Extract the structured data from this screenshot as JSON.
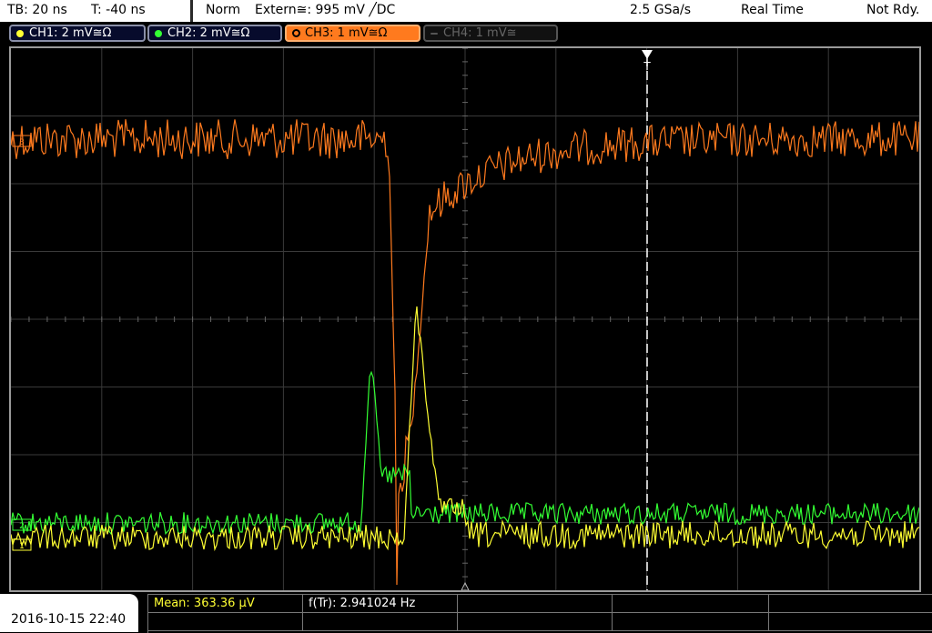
{
  "top": {
    "timebase": "TB: 20 ns",
    "trigger_time": "T: -40 ns",
    "mode": "Norm",
    "trigger_source": "Extern≅: 995 mV ╱DC",
    "sample_rate": "2.5 GSa/s",
    "acq_mode": "Real Time",
    "state": "Not Rdy."
  },
  "channels": [
    {
      "label": "CH1: 2 mV≅Ω",
      "color": "#ffff33"
    },
    {
      "label": "CH2: 2 mV≅Ω",
      "color": "#33ff33"
    },
    {
      "label": "CH3: 1 mV≅Ω",
      "color": "#ff7a1e"
    },
    {
      "label": "CH4: 1 mV≅",
      "color": "#777777"
    }
  ],
  "trigger_marker": "T",
  "measurements": {
    "mean": "Mean: 363.36 µV",
    "freq": "f(Tr): 2.941024 Hz"
  },
  "datetime": "2016-10-15 22:40",
  "colors": {
    "ch1": "#ffff33",
    "ch2": "#33ff33",
    "ch3": "#ff7a1e",
    "grid": "#3a3a3a"
  }
}
